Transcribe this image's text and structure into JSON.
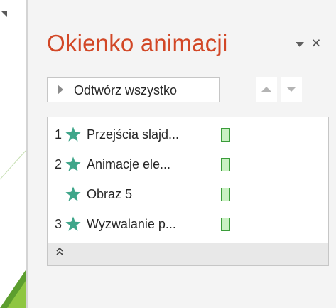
{
  "pane": {
    "title": "Okienko animacji",
    "menu_icon": "dropdown-triangle-icon",
    "close_label": "×"
  },
  "toolbar": {
    "play_all_label": "Odtwórz wszystko",
    "play_icon": "play-triangle-icon",
    "move_up_icon": "arrow-up-icon",
    "move_down_icon": "arrow-down-icon"
  },
  "animations": [
    {
      "number": "1",
      "label": "Przejścia slajd...",
      "icon": "star-icon"
    },
    {
      "number": "2",
      "label": "Animacje ele...",
      "icon": "star-icon"
    },
    {
      "number": "",
      "label": "Obraz 5",
      "icon": "star-icon"
    },
    {
      "number": "3",
      "label": "Wyzwalanie p...",
      "icon": "star-icon"
    }
  ],
  "collapse_icon": "double-chevron-up-icon",
  "colors": {
    "title": "#d24726",
    "star": "#3fa68a",
    "timing_fill": "#c9f0c2",
    "timing_border": "#3a9c3a",
    "slide_accent": "#7cb342"
  }
}
